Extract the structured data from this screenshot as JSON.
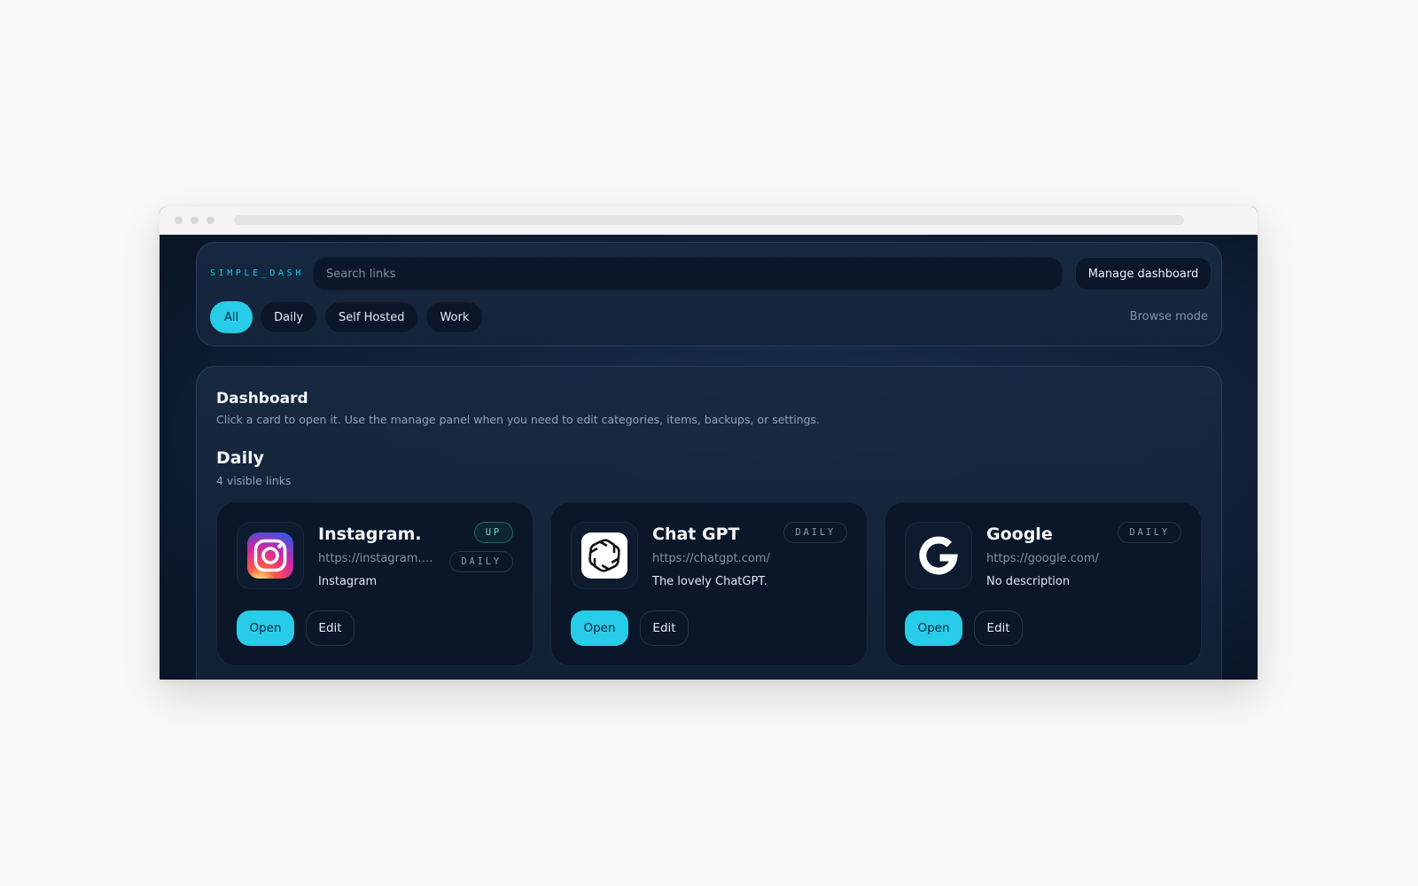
{
  "brand": {
    "logo_text": "SIMPLE_DASH",
    "accent_color": "#27cde8"
  },
  "search": {
    "placeholder": "Search links"
  },
  "header": {
    "manage_label": "Manage dashboard",
    "mode_label": "Browse mode"
  },
  "filters": {
    "active": "All",
    "items": [
      {
        "label": "All"
      },
      {
        "label": "Daily"
      },
      {
        "label": "Self Hosted"
      },
      {
        "label": "Work"
      }
    ]
  },
  "dashboard": {
    "title": "Dashboard",
    "subtitle": "Click a card to open it. Use the manage panel when you need to edit categories, items, backups, or settings."
  },
  "section": {
    "title": "Daily",
    "count_label": "4 visible links",
    "cards": [
      {
        "name": "Instagram.",
        "url": "https://instagram.com/",
        "description": "Instagram",
        "icon": "instagram-logo-icon",
        "badges": [
          "UP",
          "DAILY"
        ],
        "open_label": "Open",
        "edit_label": "Edit"
      },
      {
        "name": "Chat GPT",
        "url": "https://chatgpt.com/",
        "description": "The lovely ChatGPT.",
        "icon": "openai-logo-icon",
        "badges": [
          "DAILY"
        ],
        "open_label": "Open",
        "edit_label": "Edit"
      },
      {
        "name": "Google",
        "url": "https://google.com/",
        "description": "No description",
        "icon": "google-logo-icon",
        "badges": [
          "DAILY"
        ],
        "open_label": "Open",
        "edit_label": "Edit"
      }
    ]
  }
}
